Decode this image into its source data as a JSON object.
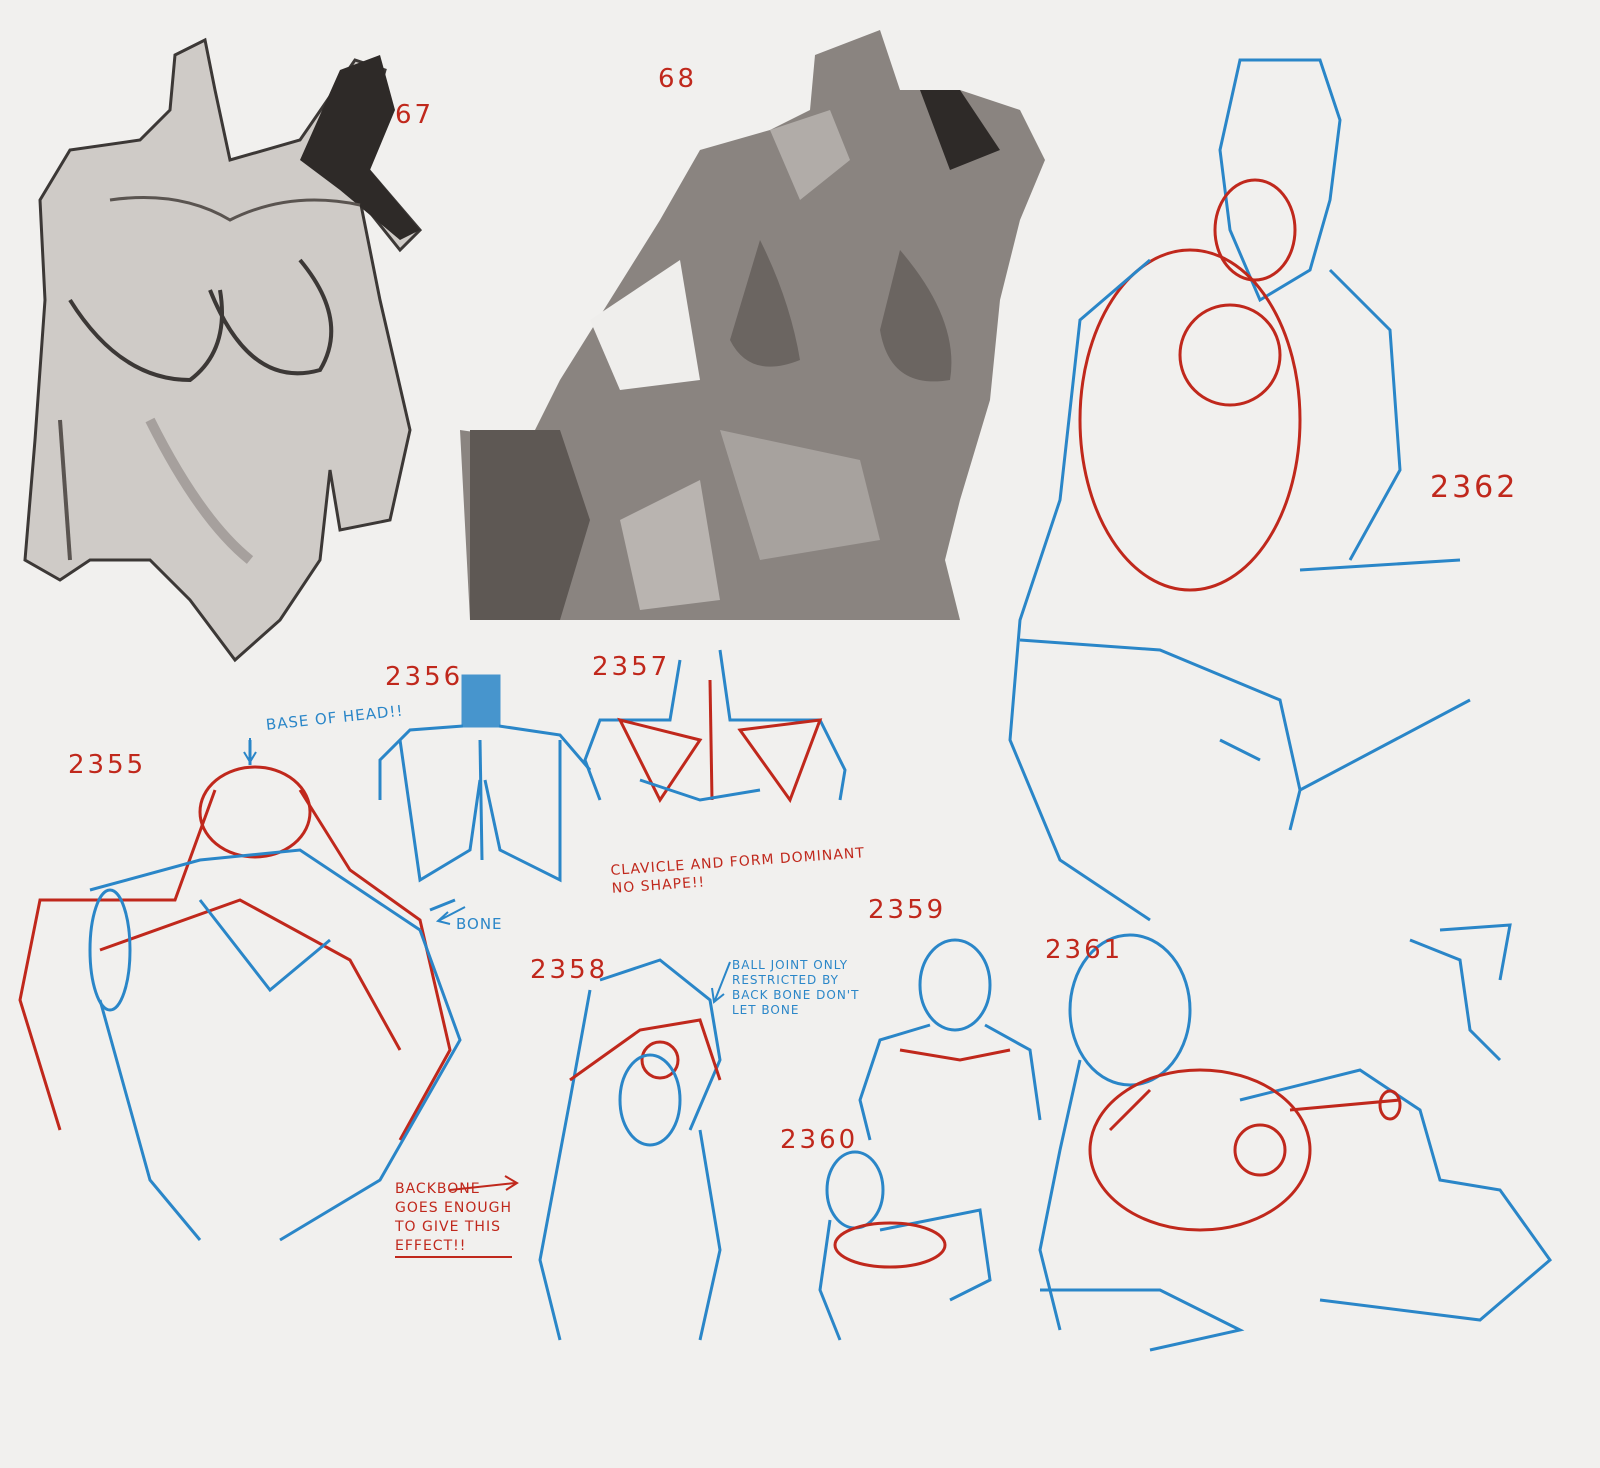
{
  "colors": {
    "background": "#f1f0ee",
    "red_ink": "#c0281c",
    "blue_ink": "#2a86c8",
    "grey_paint": "#8a8480",
    "dark_paint": "#2e2a28"
  },
  "labels": {
    "n67": "67",
    "n68": "68",
    "n2355": "2355",
    "n2356": "2356",
    "n2357": "2357",
    "n2358": "2358",
    "n2359": "2359",
    "n2360": "2360",
    "n2361": "2361",
    "n2362": "2362"
  },
  "notes": {
    "base_of_head": "BASE OF HEAD!!",
    "bone": "BONE",
    "clavicle": "CLAVICLE AND FORM DOMINANT\nNO SHAPE!!",
    "ball_joint": "BALL JOINT ONLY\nRESTRICTED BY\nBACK BONE DON'T\nLET BONE",
    "backbone": "BACKBONE\nGOES ENOUGH\nTO GIVE THIS\nEFFECT!!"
  }
}
